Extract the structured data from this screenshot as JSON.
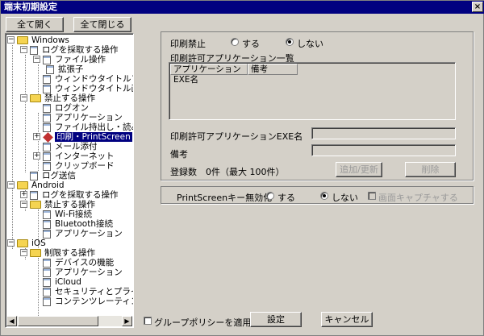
{
  "window": {
    "title": "端末初期設定",
    "close_glyph": "×"
  },
  "toolbar": {
    "expand_all": "全て開く",
    "collapse_all": "全て閉じる"
  },
  "tree": [
    {
      "label": "Windows"
    },
    {
      "label": "ログを採取する操作"
    },
    {
      "label": "ファイル操作"
    },
    {
      "label": "拡張子"
    },
    {
      "label": "ウィンドウタイトルフィルタ"
    },
    {
      "label": "ウィンドウタイトル画面キャ"
    },
    {
      "label": "禁止する操作"
    },
    {
      "label": "ログオン"
    },
    {
      "label": "アプリケーション"
    },
    {
      "label": "ファイル持出し・読み込み"
    },
    {
      "label": "印刷・PrintScreen"
    },
    {
      "label": "メール添付"
    },
    {
      "label": "インターネット"
    },
    {
      "label": "クリップボード"
    },
    {
      "label": "ログ送信"
    },
    {
      "label": "Android"
    },
    {
      "label": "ログを採取する操作"
    },
    {
      "label": "禁止する操作"
    },
    {
      "label": "Wi-Fi接続"
    },
    {
      "label": "Bluetooth接続"
    },
    {
      "label": "アプリケーション"
    },
    {
      "label": "iOS"
    },
    {
      "label": "制限する操作"
    },
    {
      "label": "デバイスの機能"
    },
    {
      "label": "アプリケーション"
    },
    {
      "label": "iCloud"
    },
    {
      "label": "セキュリティとプライバシー"
    },
    {
      "label": "コンテンツレーティング"
    }
  ],
  "print": {
    "ban_label": "印刷禁止",
    "option_yes": "する",
    "option_no": "しない",
    "selected": "しない",
    "allowed_list_label": "印刷許可アプリケーション一覧",
    "columns": [
      "アプリケーションEXE名",
      "備考"
    ],
    "exe_label": "印刷許可アプリケーションEXE名",
    "exe_value": "",
    "note_label": "備考",
    "note_value": "",
    "count_text": "登録数　0件（最大 100件）",
    "add_update": "追加/更新",
    "delete": "削除"
  },
  "printscreen": {
    "label": "PrintScreenキー無効化",
    "option_yes": "する",
    "option_no": "しない",
    "selected": "しない",
    "capture_label": "画面キャプチャする"
  },
  "footer": {
    "group_policy": "グループポリシーを適用",
    "ok": "設定",
    "cancel": "キャンセル"
  },
  "scroll": {
    "left_arrow": "◀",
    "right_arrow": "▶"
  }
}
